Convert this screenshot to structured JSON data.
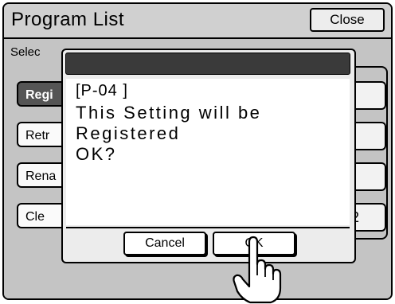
{
  "header": {
    "title": "Program List",
    "close_label": "Close"
  },
  "main": {
    "instruction": "Selec",
    "buttons": [
      {
        "label": "Regi",
        "active": true
      },
      {
        "label": "Retr",
        "active": false
      },
      {
        "label": "Rena",
        "active": false
      },
      {
        "label": "Cle",
        "active": false
      }
    ],
    "right_slot_glyphs": [
      ")",
      ")",
      "",
      "2"
    ]
  },
  "dialog": {
    "program_id": "[P-04        ]",
    "line1": "This Setting will be",
    "line2": "Registered",
    "line3": "OK?",
    "cancel_label": "Cancel",
    "ok_label": "OK"
  },
  "icons": {
    "pointer": "pointing-hand-icon"
  },
  "colors": {
    "active_button": "#555555",
    "dialog_title": "#3a3a3a",
    "background": "#c4c4c4"
  }
}
